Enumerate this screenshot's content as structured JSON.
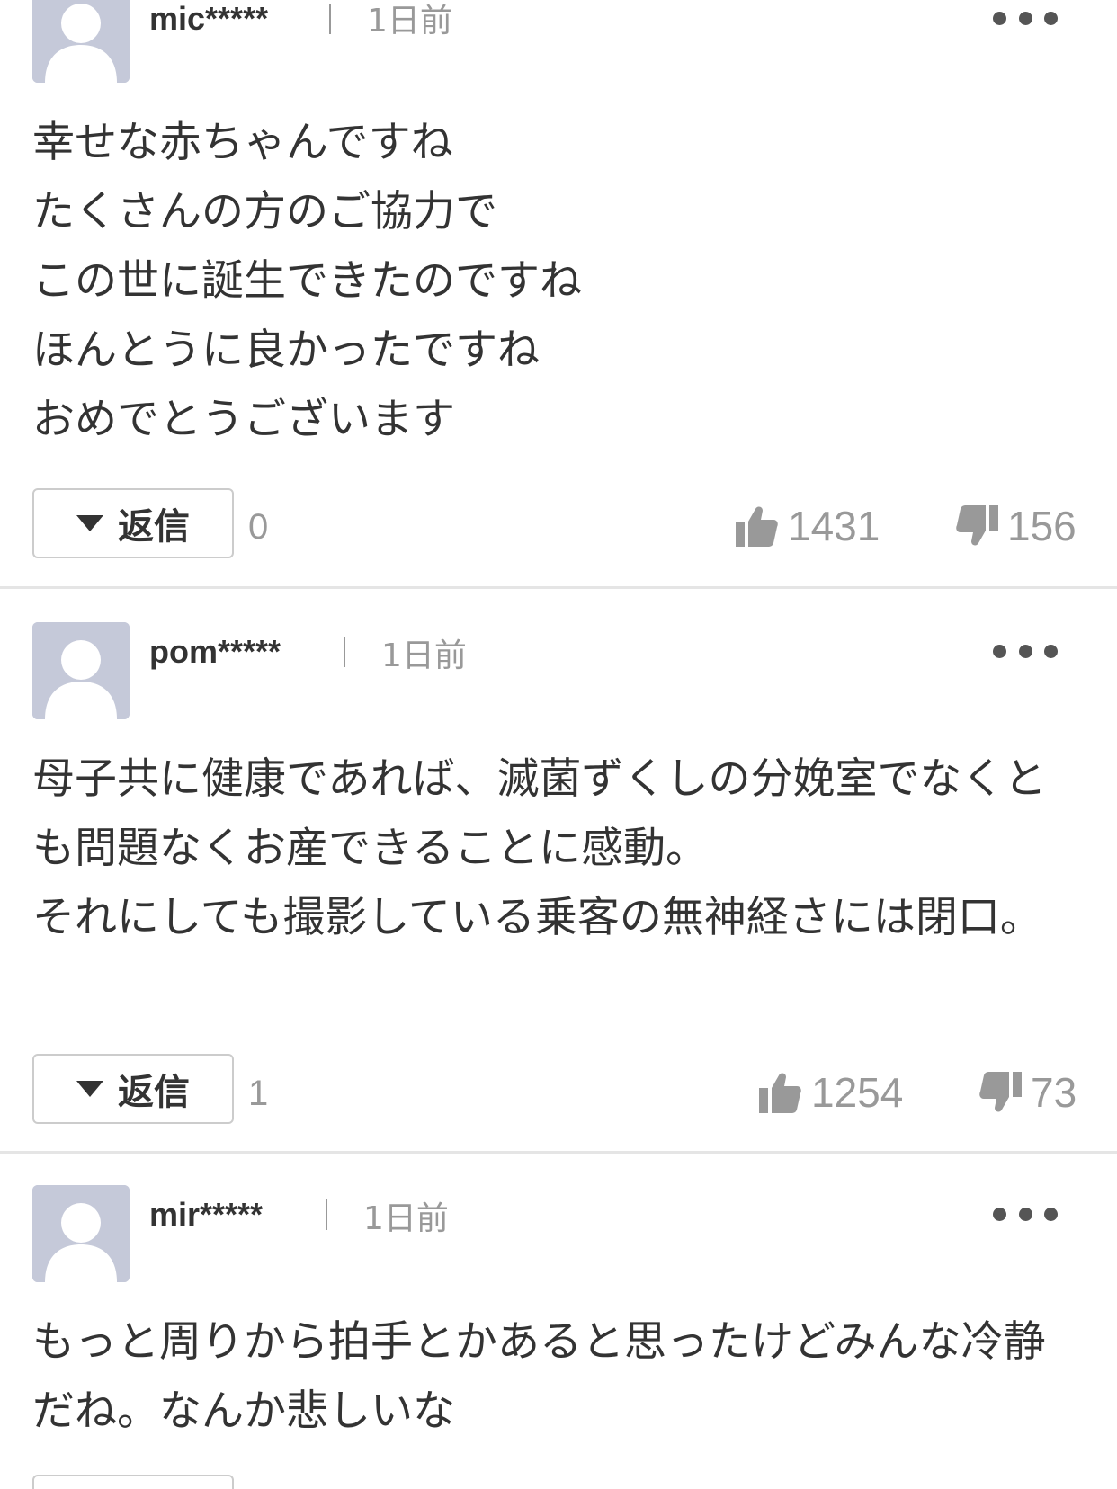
{
  "comments": [
    {
      "username": "mic*****",
      "time": "1日前",
      "text": "幸せな赤ちゃんですね\nたくさんの方のご協力で\nこの世に誕生できたのですね\nほんとうに良かったですね\nおめでとうございます",
      "reply_label": "返信",
      "reply_count": "0",
      "likes": "1431",
      "dislikes": "156"
    },
    {
      "username": "pom*****",
      "time": "1日前",
      "text": "母子共に健康であれば、滅菌ずくしの分娩室でなくとも問題なくお産できることに感動。\nそれにしても撮影している乗客の無神経さには閉口。",
      "reply_label": "返信",
      "reply_count": "1",
      "likes": "1254",
      "dislikes": "73"
    },
    {
      "username": "mir*****",
      "time": "1日前",
      "text": "もっと周りから拍手とかあると思ったけどみんな冷静だね。なんか悲しいな"
    }
  ],
  "icons": {
    "avatar": "default-user-avatar-icon",
    "more": "more-options-icon",
    "like": "thumbs-up-icon",
    "dislike": "thumbs-down-icon",
    "reply_toggle": "triangle-down-icon"
  },
  "colors": {
    "avatar_bg": "#c5c9d9",
    "meta_text": "#999999",
    "body_text": "#333333",
    "divider": "#e5e5e5"
  }
}
